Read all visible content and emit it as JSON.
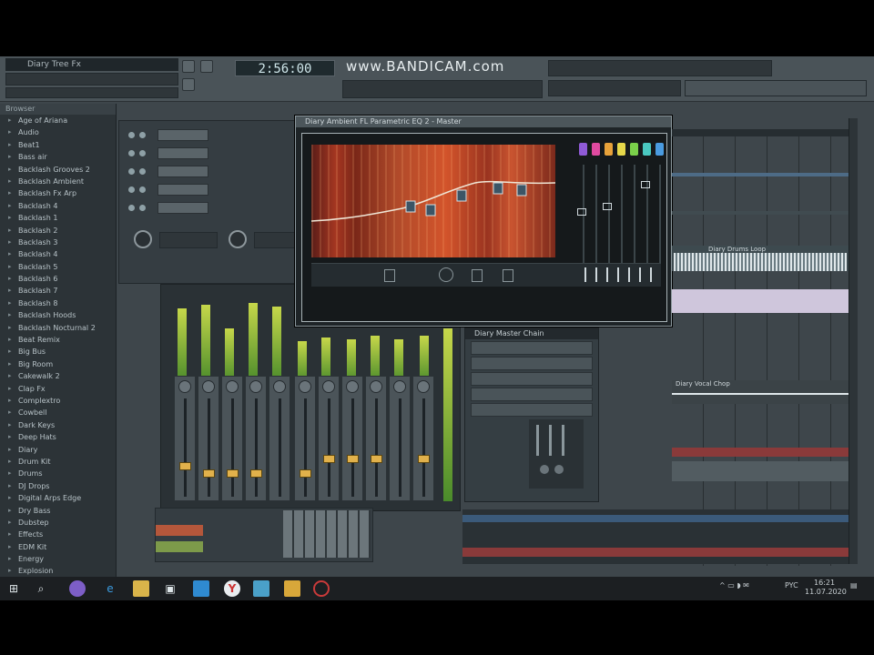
{
  "window": {
    "song_title": "Diary Tree Fx",
    "time_display": "2:56:00",
    "watermark": "www.BANDICAM.com"
  },
  "browser": {
    "header": "Browser",
    "items": [
      "Age of Ariana",
      "Audio",
      "Beat1",
      "Bass air",
      "Backlash Grooves 2",
      "Backlash Ambient",
      "Backlash Fx Arp",
      "Backlash 4",
      "Backlash 1",
      "Backlash 2",
      "Backlash 3",
      "Backlash 4",
      "Backlash 5",
      "Backlash 6",
      "Backlash 7",
      "Backlash 8",
      "Backlash Hoods",
      "Backlash Nocturnal 2",
      "Beat Remix",
      "Big Bus",
      "Big Room",
      "Cakewalk 2",
      "Clap Fx",
      "Complextro",
      "Cowbell",
      "Dark Keys",
      "Deep Hats",
      "Diary",
      "Drum Kit",
      "Drums",
      "DJ Drops",
      "Digital Arps Edge",
      "Dry Bass",
      "Dubstep",
      "Effects",
      "EDM Kit",
      "Energy",
      "Explosion"
    ]
  },
  "eq_window": {
    "title": "Diary Ambient FL Parametric EQ 2 - Master"
  },
  "plugin_panel": {
    "title": "Diary Master Chain"
  },
  "playlist": {
    "clip_1": "Diary Drums Loop",
    "clip_2": "Diary Vocal Chop"
  },
  "colors": {
    "accent": "#e1b14b",
    "meter_green": "#4a8b2b",
    "eq_red": "#b04a2a",
    "background": "#3e464b"
  },
  "taskbar": {
    "time": "16:21",
    "date": "11.07.2020",
    "lang": "PYC",
    "icons": [
      "windows-icon",
      "search-icon",
      "task-view-icon",
      "edge-icon",
      "explorer-icon",
      "store-icon",
      "mail-icon",
      "yandex-icon",
      "photos-icon",
      "fl-studio-icon",
      "record-icon"
    ]
  }
}
